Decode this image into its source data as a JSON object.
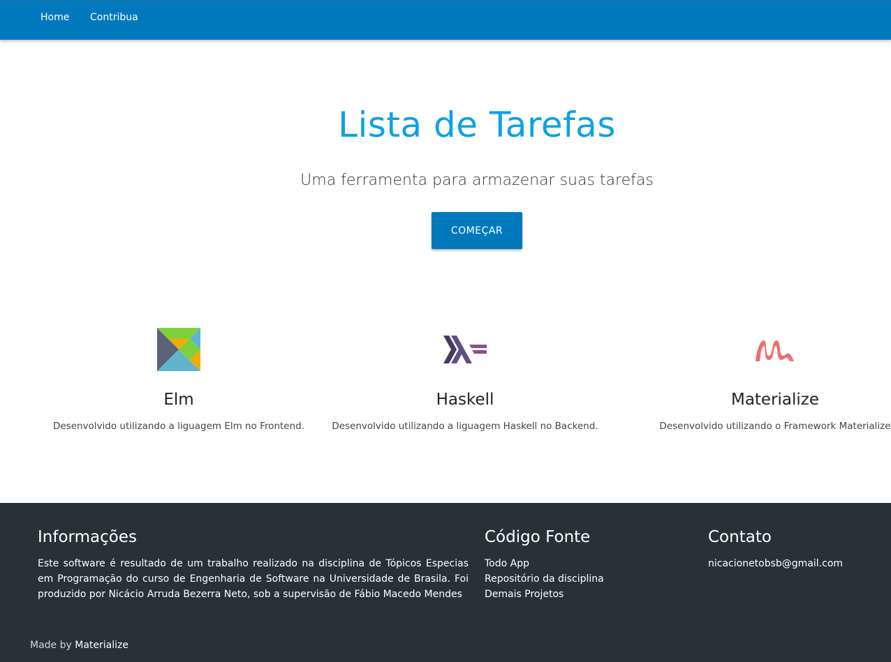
{
  "nav": {
    "home": "Home",
    "contribua": "Contribua"
  },
  "hero": {
    "title": "Lista de Tarefas",
    "subtitle": "Uma ferramenta para armazenar suas tarefas",
    "cta": "COMEÇAR"
  },
  "features": [
    {
      "icon": "elm-logo-icon",
      "title": "Elm",
      "text": "Desenvolvido utilizando a liguagem Elm no Frontend."
    },
    {
      "icon": "haskell-logo-icon",
      "title": "Haskell",
      "text": "Desenvolvido utilizando a liguagem Haskell no Backend."
    },
    {
      "icon": "materialize-logo-icon",
      "title": "Materialize",
      "text": "Desenvolvido utilizando o Framework Materialize"
    }
  ],
  "footer": {
    "info_title": "Informações",
    "info_text": "Este software é resultado de um trabalho realizado na disciplina de Tópicos Especias em Programação do curso de Engenharia de Software na Universidade de Brasila. Foi produzido por Nicácio Arruda Bezerra Neto, sob a supervisão de Fábio Macedo Mendes",
    "code_title": "Código Fonte",
    "code_links": [
      "Todo App",
      "Repositório da disciplina",
      "Demais Projetos"
    ],
    "contact_title": "Contato",
    "contact_email": "nicacionetobsb@gmail.com",
    "made_by_prefix": "Made by ",
    "made_by_link": "Materialize"
  },
  "colors": {
    "primary": "#0079bd",
    "title": "#0ba2e4",
    "footer_bg": "#263238"
  }
}
